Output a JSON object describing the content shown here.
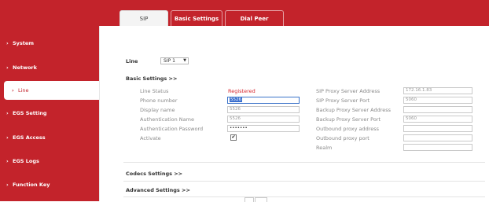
{
  "tabs": [
    {
      "label": "SIP",
      "active": true
    },
    {
      "label": "Basic Settings",
      "active": false
    },
    {
      "label": "Dial Peer",
      "active": false
    }
  ],
  "sidebar": {
    "items": [
      {
        "label": "System"
      },
      {
        "label": "Network"
      },
      {
        "label": "Line",
        "active": true
      },
      {
        "label": "EGS Setting"
      },
      {
        "label": "EGS Access"
      },
      {
        "label": "EGS Logs"
      },
      {
        "label": "Function Key"
      }
    ]
  },
  "line_selector": {
    "label": "Line",
    "value": "SIP 1"
  },
  "basic_settings": {
    "title": "Basic Settings >>",
    "left": [
      {
        "label": "Line Status",
        "value": "Registered"
      },
      {
        "label": "Phone number",
        "value": "5526"
      },
      {
        "label": "Display name",
        "value": "5526"
      },
      {
        "label": "Authentication Name",
        "value": "5526"
      },
      {
        "label": "Authentication Password",
        "value": "•••••••"
      },
      {
        "label": "Activate",
        "value": "✔"
      }
    ],
    "right": [
      {
        "label": "SIP Proxy Server Address",
        "value": "172.16.1.83"
      },
      {
        "label": "SIP Proxy Server Port",
        "value": "5060"
      },
      {
        "label": "Backup Proxy Server Address",
        "value": ""
      },
      {
        "label": "Backup Proxy Server Port",
        "value": "5060"
      },
      {
        "label": "Outbound proxy address",
        "value": ""
      },
      {
        "label": "Outbound proxy port",
        "value": ""
      },
      {
        "label": "Realm",
        "value": ""
      }
    ]
  },
  "codecs_settings": {
    "title": "Codecs Settings >>"
  },
  "advanced_settings": {
    "title": "Advanced Settings >>"
  },
  "colors": {
    "brand_red": "#c3232b",
    "status_red": "#d7262e",
    "focus_blue": "#3a73c9"
  }
}
